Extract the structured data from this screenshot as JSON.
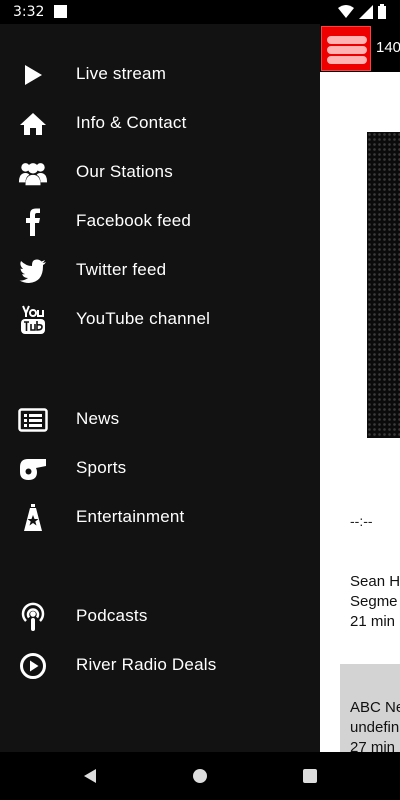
{
  "status": {
    "time": "3:32"
  },
  "app": {
    "title": "140"
  },
  "drawer": {
    "items": [
      {
        "label": "Live stream",
        "icon": "play-icon"
      },
      {
        "label": "Info & Contact",
        "icon": "home-icon"
      },
      {
        "label": "Our Stations",
        "icon": "group-icon"
      },
      {
        "label": "Facebook feed",
        "icon": "facebook-icon"
      },
      {
        "label": "Twitter feed",
        "icon": "twitter-icon"
      },
      {
        "label": "YouTube channel",
        "icon": "youtube-icon"
      },
      {
        "label": "News",
        "icon": "newspaper-icon"
      },
      {
        "label": "Sports",
        "icon": "whistle-icon"
      },
      {
        "label": "Entertainment",
        "icon": "star-award-icon"
      },
      {
        "label": "Podcasts",
        "icon": "podcast-icon"
      },
      {
        "label": "River Radio Deals",
        "icon": "play-circle-icon"
      }
    ]
  },
  "content": {
    "time_readout": "--:--",
    "items": [
      {
        "line1": "Sean H",
        "line2": "Segme",
        "line3": "21 min"
      },
      {
        "line1": "ABC Ne",
        "line2": "undefin",
        "line3": "27 min"
      }
    ]
  },
  "colors": {
    "accent": "#e00000",
    "drawer_bg": "#121212"
  }
}
